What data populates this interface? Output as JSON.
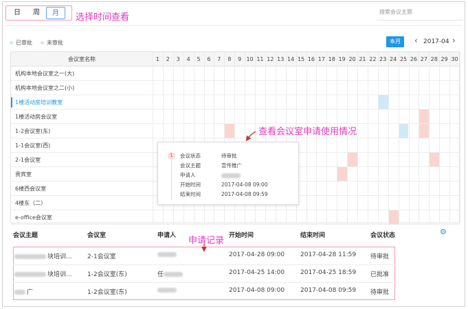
{
  "view_tabs": {
    "day": "日",
    "week": "周",
    "month": "月"
  },
  "annotations": {
    "select_time": "选择时间查看",
    "view_usage": "查看会议室申请使用情况",
    "records": "申请记录"
  },
  "search": {
    "placeholder": "搜索会议主题"
  },
  "legend": {
    "approved": "已审批",
    "pending": "未审批",
    "approved_color": "#cfe9f8",
    "pending_color": "#fad5d0"
  },
  "calendar": {
    "this_month": "本月",
    "current_month": "2017-04",
    "prev_icon": "chevron-left-icon",
    "next_icon": "chevron-right-icon",
    "name_header": "会议室名称",
    "days": [
      "1",
      "2",
      "3",
      "4",
      "5",
      "6",
      "7",
      "8",
      "9",
      "10",
      "11",
      "12",
      "13",
      "14",
      "15",
      "16",
      "17",
      "18",
      "19",
      "20",
      "21",
      "22",
      "23",
      "24",
      "25",
      "26",
      "27",
      "28",
      "29",
      "30"
    ],
    "rooms": [
      "机构本地会议室之一(大)",
      "机构本地会议室之二(小)",
      "1楼活动房培训教室",
      "1楼活动房会议室",
      "1-2会议室(东)",
      "1-1会议室(西)",
      "2-1会议室",
      "贵宾室",
      "6楼西会议室",
      "4楼东（二）",
      "e-office会议室"
    ],
    "selected_room_index": 2,
    "bookings": [
      {
        "room": 2,
        "day": 23,
        "status": "approved"
      },
      {
        "room": 3,
        "day": 27,
        "status": "pending"
      },
      {
        "room": 4,
        "day": 8,
        "status": "pending"
      },
      {
        "room": 4,
        "day": 25,
        "status": "approved"
      },
      {
        "room": 4,
        "day": 27,
        "status": "pending"
      },
      {
        "room": 6,
        "day": 20,
        "status": "pending"
      },
      {
        "room": 6,
        "day": 28,
        "status": "pending"
      },
      {
        "room": 7,
        "day": 19,
        "status": "pending"
      },
      {
        "room": 10,
        "day": 24,
        "status": "pending"
      }
    ]
  },
  "popup": {
    "index": "1",
    "status_label": "会议状态",
    "status_value": "待审批",
    "subject_label": "会议主题",
    "subject_value": "宣传推广",
    "applicant_label": "申请人",
    "start_label": "开始时间",
    "start_value": "2017-04-08 09:00",
    "end_label": "结束时间",
    "end_value": "2017-04-08 09:59"
  },
  "records": {
    "headers": {
      "subject": "会议主题",
      "room": "会议室",
      "applicant": "申请人",
      "start": "开始时间",
      "end": "结束时间",
      "status": "会议状态"
    },
    "settings_icon": "gear-icon",
    "rows": [
      {
        "subject": "块培训...",
        "room": "2-1会议室",
        "applicant": "",
        "start": "2017-04-28 09:00",
        "end": "2017-04-28 11:59",
        "status": "待审批"
      },
      {
        "subject": "块培训...",
        "room": "1-2会议室(东)",
        "applicant": "任",
        "start": "2017-04-25 14:00",
        "end": "2017-04-25 18:59",
        "status": "已批准"
      },
      {
        "subject": "广",
        "room": "1-2会议室(东)",
        "applicant": "",
        "start": "2017-04-08 09:00",
        "end": "2017-04-08 09:59",
        "status": "待审批"
      }
    ]
  }
}
